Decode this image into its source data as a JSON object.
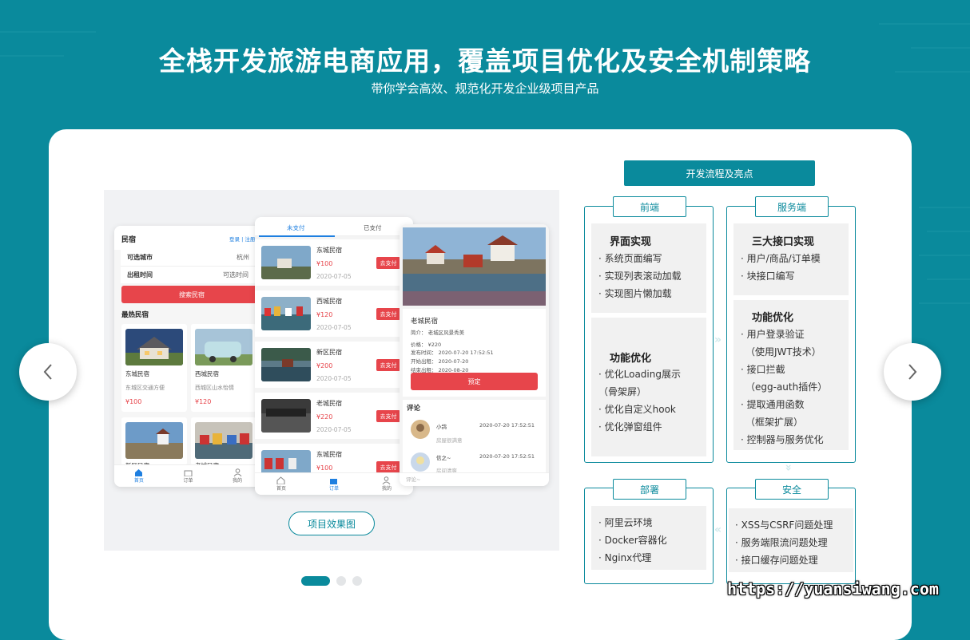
{
  "header": {
    "title": "全栈开发旅游电商应用，覆盖项目优化及安全机制策略",
    "subtitle": "带你学会高效、规范化开发企业级项目产品"
  },
  "gallery": {
    "button_label": "项目效果图",
    "prev_icon": "chevron-left-icon",
    "next_icon": "chevron-right-icon",
    "dots_total": 3,
    "dots_active": 0
  },
  "phone1": {
    "title": "民宿",
    "login": "登录 | 注册",
    "city_label": "可选城市",
    "city_value": "杭州",
    "time_label": "出租时间",
    "time_value": "可选时间",
    "search_btn": "搜索民宿",
    "hot_title": "最热民宿",
    "cards": [
      {
        "name": "东城民宿",
        "desc": "东城区交通方便",
        "price": "¥100"
      },
      {
        "name": "西城民宿",
        "desc": "西城区山水怡情",
        "price": "¥120"
      },
      {
        "name": "新区民宿"
      },
      {
        "name": "老城民宿"
      }
    ],
    "nav": [
      "首页",
      "订单",
      "我的"
    ]
  },
  "phone2": {
    "tabs": [
      "未支付",
      "已支付"
    ],
    "orders": [
      {
        "name": "东城民宿",
        "price": "¥100",
        "date": "2020-07-05",
        "btn": "去支付"
      },
      {
        "name": "西城民宿",
        "price": "¥120",
        "date": "2020-07-05",
        "btn": "去支付"
      },
      {
        "name": "新区民宿",
        "price": "¥200",
        "date": "2020-07-05",
        "btn": "去支付"
      },
      {
        "name": "老城民宿",
        "price": "¥220",
        "date": "2020-07-05",
        "btn": "去支付"
      },
      {
        "name": "东城民宿",
        "price": "¥100",
        "btn": "去支付"
      }
    ],
    "nav": [
      "首页",
      "订单",
      "我的"
    ]
  },
  "phone3": {
    "name": "老城民宿",
    "intro": "简介：  老城区风景秀美",
    "price": "价格：  ¥220",
    "publish": "发布时间：  2020-07-20 17:52:51",
    "start": "开始出租：  2020-07-20",
    "end": "结束出租：  2020-08-20",
    "book_btn": "预定",
    "comments_title": "评论",
    "comments": [
      {
        "user": "小鸽",
        "time": "2020-07-20 17:52:51",
        "text": "房屋很满意"
      },
      {
        "user": "信之~",
        "time": "2020-07-20 17:52:51",
        "text": "房间清爽"
      }
    ],
    "comment_placeholder": "评论~"
  },
  "flow": {
    "heading": "开发流程及亮点",
    "frontend": {
      "tag": "前端",
      "g1_title": "界面实现",
      "g1_items": [
        "· 系统页面编写",
        "· 实现列表滚动加载",
        "· 实现图片懒加载"
      ],
      "g2_title": "功能优化",
      "g2_items": [
        "· 优化Loading展示",
        "（骨架屏）",
        "· 优化自定义hook",
        "· 优化弹窗组件"
      ]
    },
    "server": {
      "tag": "服务端",
      "g1_title": "三大接口实现",
      "g1_items": [
        "· 用户/商品/订单模",
        "· 块接口编写"
      ],
      "g2_title": "功能优化",
      "g2_items": [
        "· 用户登录验证",
        "（使用JWT技术）",
        "· 接口拦截",
        "（egg-auth插件）",
        "· 提取通用函数",
        "（框架扩展）",
        "· 控制器与服务优化"
      ]
    },
    "deploy": {
      "tag": "部署",
      "items": [
        "· 阿里云环境",
        "· Docker容器化",
        "· Nginx代理"
      ]
    },
    "security": {
      "tag": "安全",
      "items": [
        "· XSS与CSRF问题处理",
        "· 服务端限流问题处理",
        "· 接口缓存问题处理"
      ]
    }
  },
  "watermark": "https://yuansiwang.com"
}
